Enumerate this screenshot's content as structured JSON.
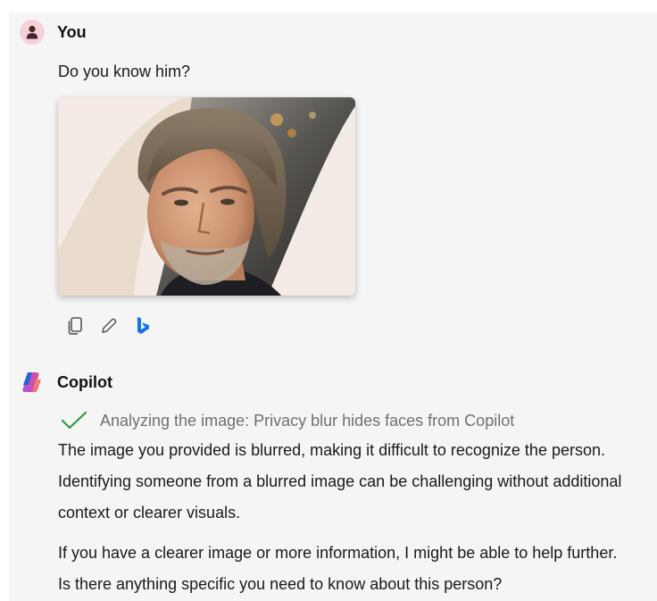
{
  "user_message": {
    "author": "You",
    "text": "Do you know him?"
  },
  "message_actions": [
    {
      "icon": "copy-icon"
    },
    {
      "icon": "pencil-icon"
    },
    {
      "icon": "bing-icon"
    }
  ],
  "copilot_message": {
    "author": "Copilot",
    "status": "Analyzing the image: Privacy blur hides faces from Copilot",
    "paragraph1": [
      "The image you provided is blurred, making it difficult to recognize the person.",
      "Identifying someone from a blurred image can be challenging without additional",
      "context or clearer visuals."
    ],
    "paragraph2": [
      "If you have a clearer image or more information, I might be able to help further.",
      "Is there anything specific you need to know about this person?"
    ]
  },
  "colors": {
    "panel_bg": "#f5f5f5",
    "user_avatar_bg": "#f3d2d8",
    "check_green": "#2e9a44",
    "bing_blue": "#1a73e8"
  }
}
